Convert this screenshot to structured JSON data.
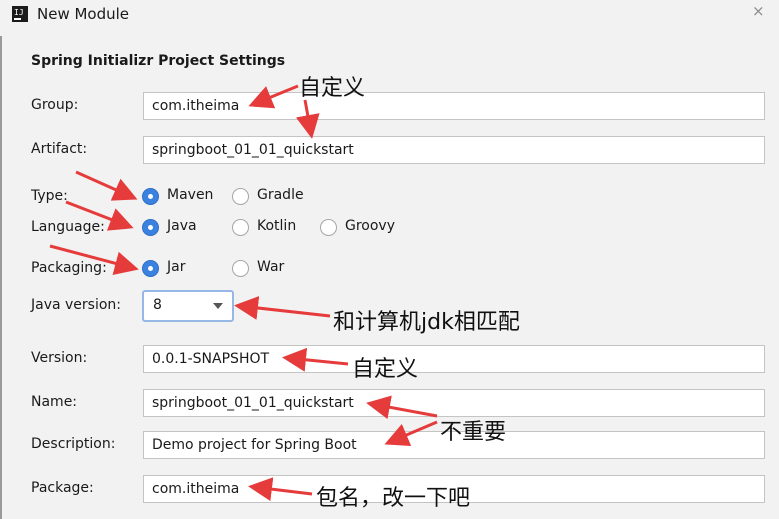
{
  "window": {
    "title": "New Module",
    "close_glyph": "×",
    "icon": "intellij-idea-icon"
  },
  "section_title": "Spring Initializr Project Settings",
  "form": {
    "group": {
      "label": "Group:",
      "value": "com.itheima"
    },
    "artifact": {
      "label": "Artifact:",
      "value": "springboot_01_01_quickstart"
    },
    "type": {
      "label": "Type:",
      "options": [
        "Maven",
        "Gradle"
      ],
      "selected": "Maven"
    },
    "language": {
      "label": "Language:",
      "options": [
        "Java",
        "Kotlin",
        "Groovy"
      ],
      "selected": "Java"
    },
    "packaging": {
      "label": "Packaging:",
      "options": [
        "Jar",
        "War"
      ],
      "selected": "Jar"
    },
    "java_version": {
      "label": "Java version:",
      "value": "8"
    },
    "version": {
      "label": "Version:",
      "value": "0.0.1-SNAPSHOT"
    },
    "name": {
      "label": "Name:",
      "value": "springboot_01_01_quickstart"
    },
    "description": {
      "label": "Description:",
      "value": "Demo project for Spring Boot"
    },
    "package": {
      "label": "Package:",
      "value": "com.itheima"
    }
  },
  "annotations": {
    "group_artifact_note": "自定义",
    "java_version_note": "和计算机jdk相匹配",
    "version_note": "自定义",
    "name_description_note": "不重要",
    "package_note": "包名，改一下吧"
  },
  "colors": {
    "arrow": "#e63b3b",
    "radio_selected": "#3b82e0",
    "focus_border": "#97b8e6"
  }
}
